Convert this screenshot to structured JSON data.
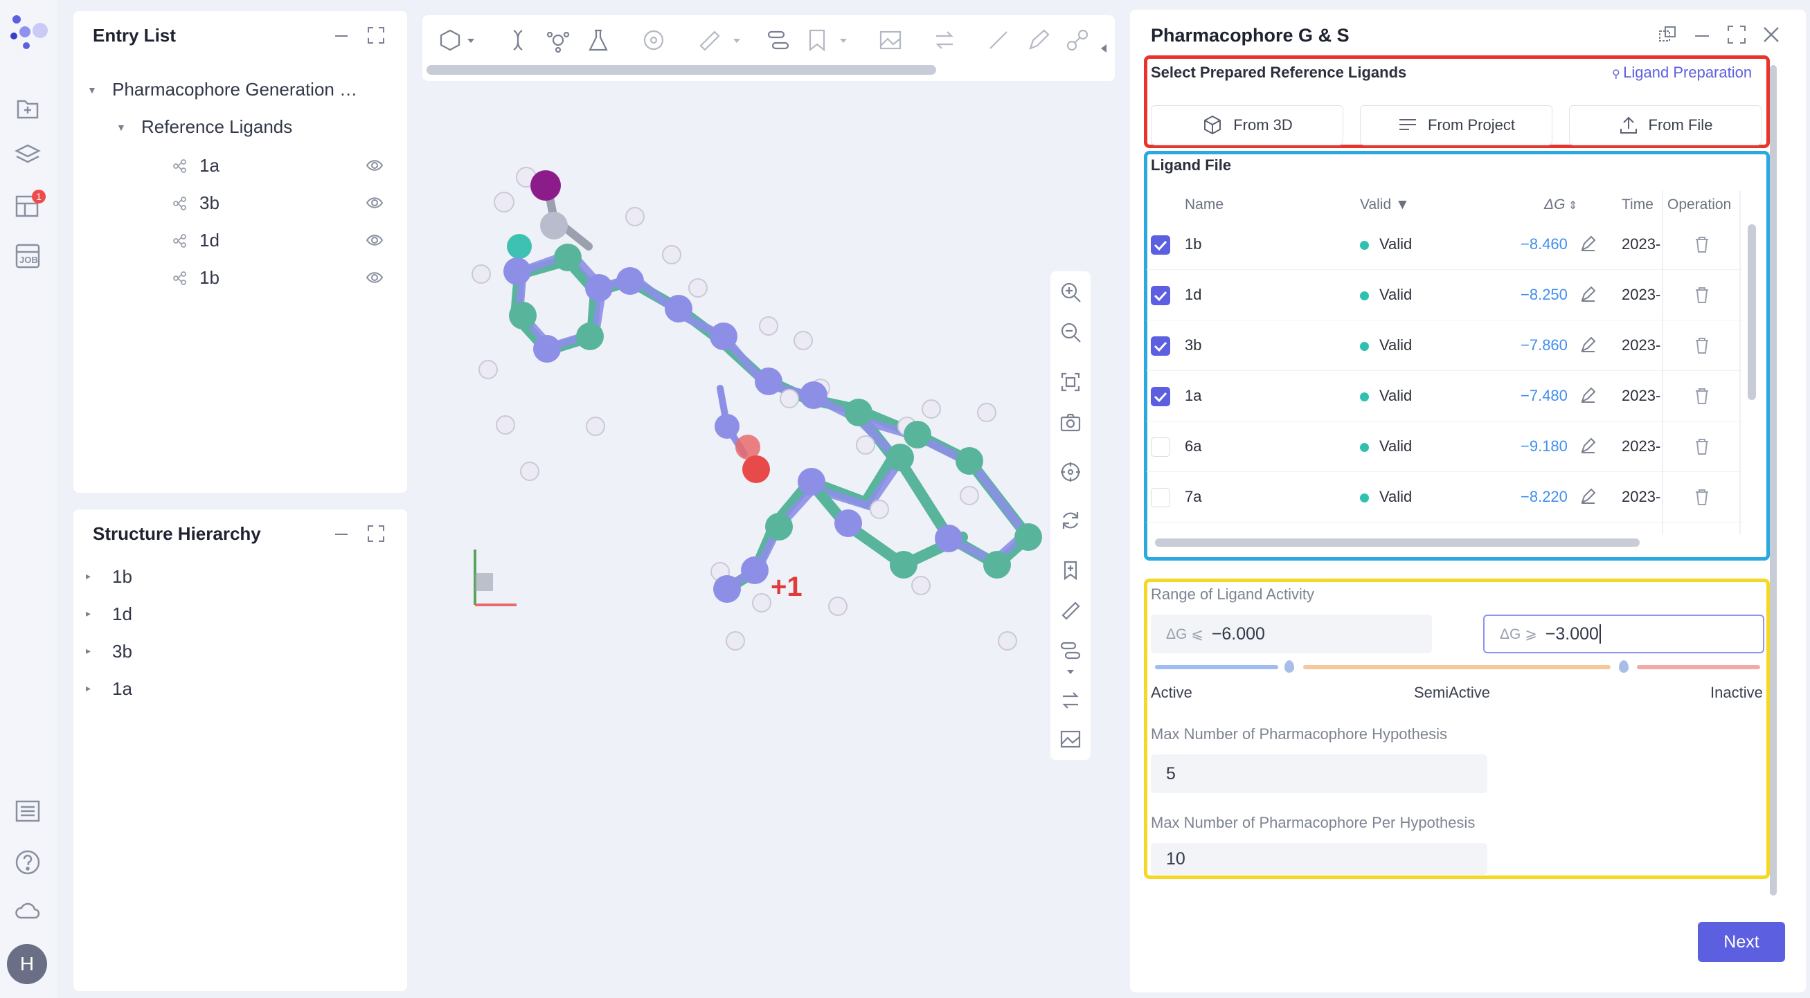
{
  "rail": {
    "badge": "1",
    "avatar": "H",
    "job_label": "JOB"
  },
  "entry_list": {
    "title": "Entry List",
    "root": "Pharmacophore Generation …",
    "group": "Reference Ligands",
    "items": [
      "1a",
      "3b",
      "1d",
      "1b"
    ]
  },
  "structure": {
    "title": "Structure Hierarchy",
    "items": [
      "1b",
      "1d",
      "3b",
      "1a"
    ]
  },
  "viewer": {
    "charge_label": "+1"
  },
  "right_panel": {
    "title": "Pharmacophore G & S",
    "select_title": "Select Prepared Reference Ligands",
    "ligand_prep_link": "Ligand Preparation",
    "buttons": {
      "from3d": "From 3D",
      "project": "From Project",
      "file": "From File"
    },
    "ligand_file": {
      "title": "Ligand File",
      "headers": {
        "name": "Name",
        "valid": "Valid",
        "dg": "ΔG",
        "time": "Time",
        "op": "Operation"
      },
      "rows": [
        {
          "checked": true,
          "name": "1b",
          "valid": "Valid",
          "dg": "−8.460",
          "time": "2023-"
        },
        {
          "checked": true,
          "name": "1d",
          "valid": "Valid",
          "dg": "−8.250",
          "time": "2023-"
        },
        {
          "checked": true,
          "name": "3b",
          "valid": "Valid",
          "dg": "−7.860",
          "time": "2023-"
        },
        {
          "checked": true,
          "name": "1a",
          "valid": "Valid",
          "dg": "−7.480",
          "time": "2023-"
        },
        {
          "checked": false,
          "name": "6a",
          "valid": "Valid",
          "dg": "−9.180",
          "time": "2023-"
        },
        {
          "checked": false,
          "name": "7a",
          "valid": "Valid",
          "dg": "−8.220",
          "time": "2023-"
        }
      ]
    },
    "activity": {
      "title": "Range of Ligand Activity",
      "min_prefix": "ΔG ⩽",
      "min_value": "−6.000",
      "max_prefix": "ΔG ⩾",
      "max_value": "−3.000",
      "active": "Active",
      "semi": "SemiActive",
      "inactive": "Inactive"
    },
    "max_hyp": {
      "label": "Max Number of Pharmacophore Hypothesis",
      "value": "5"
    },
    "max_per": {
      "label": "Max Number of Pharmacophore Per Hypothesis",
      "value": "10"
    },
    "next": "Next"
  },
  "colors": {
    "accent": "#5b5fe0",
    "red_box": "#e8352b",
    "blue_box": "#2aa8e0",
    "yellow_box": "#f5d824",
    "valid_dot": "#2fc0b0"
  }
}
